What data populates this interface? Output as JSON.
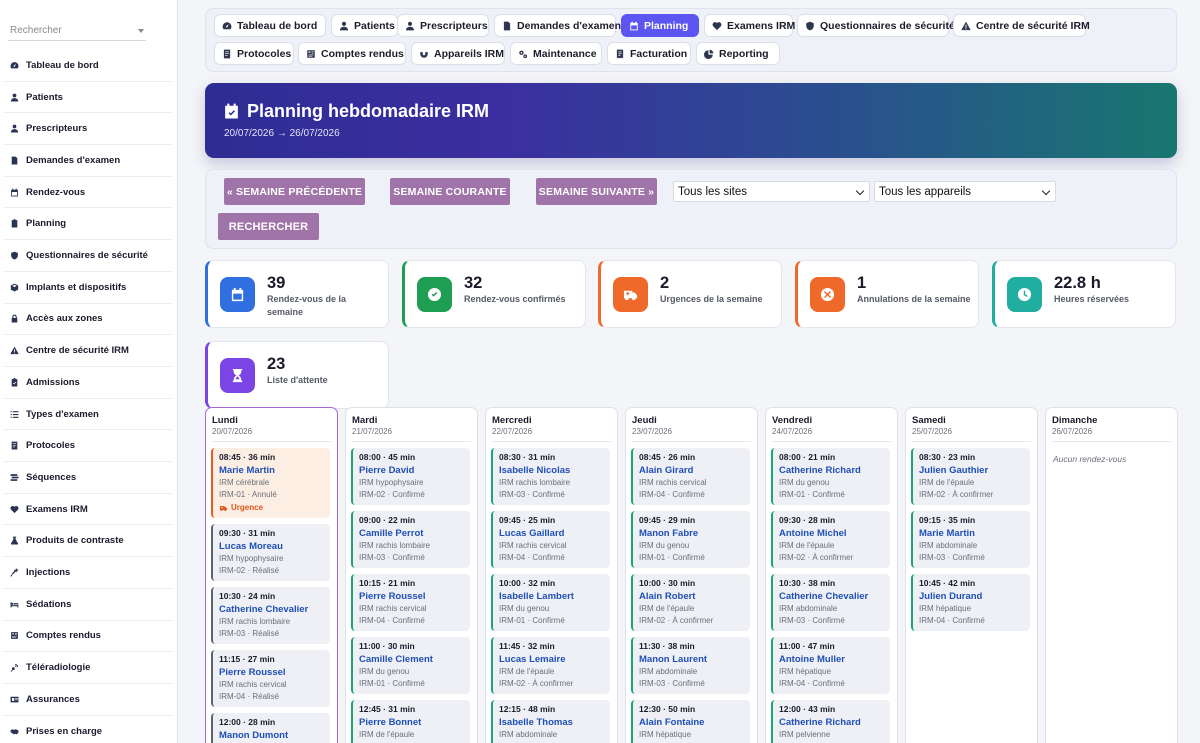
{
  "sidebar": {
    "search_placeholder": "Rechercher",
    "items": [
      {
        "label": "Tableau de bord",
        "icon": "gauge-icon"
      },
      {
        "label": "Patients",
        "icon": "user-icon"
      },
      {
        "label": "Prescripteurs",
        "icon": "doctor-icon"
      },
      {
        "label": "Demandes d'examen",
        "icon": "file-icon"
      },
      {
        "label": "Rendez-vous",
        "icon": "calendar-icon"
      },
      {
        "label": "Planning",
        "icon": "clipboard-icon"
      },
      {
        "label": "Questionnaires de sécurité",
        "icon": "shield-icon"
      },
      {
        "label": "Implants et dispositifs",
        "icon": "box-icon"
      },
      {
        "label": "Accès aux zones",
        "icon": "lock-icon"
      },
      {
        "label": "Centre de sécurité IRM",
        "icon": "warning-icon"
      },
      {
        "label": "Admissions",
        "icon": "clipboard-check-icon"
      },
      {
        "label": "Types d'examen",
        "icon": "list-icon"
      },
      {
        "label": "Protocoles",
        "icon": "doc-icon"
      },
      {
        "label": "Séquences",
        "icon": "stream-icon"
      },
      {
        "label": "Examens IRM",
        "icon": "heart-pulse-icon"
      },
      {
        "label": "Produits de contraste",
        "icon": "flask-icon"
      },
      {
        "label": "Injections",
        "icon": "syringe-icon"
      },
      {
        "label": "Sédations",
        "icon": "bed-icon"
      },
      {
        "label": "Comptes rendus",
        "icon": "report-icon"
      },
      {
        "label": "Téléradiologie",
        "icon": "satellite-icon"
      },
      {
        "label": "Assurances",
        "icon": "id-card-icon"
      },
      {
        "label": "Prises en charge",
        "icon": "handshake-icon"
      }
    ]
  },
  "topnav": {
    "tabs": [
      {
        "label": "Tableau de bord",
        "icon": "gauge-icon"
      },
      {
        "label": "Patients",
        "icon": "user-icon"
      },
      {
        "label": "Prescripteurs",
        "icon": "doctor-icon"
      },
      {
        "label": "Demandes d'examen",
        "icon": "file-icon"
      },
      {
        "label": "Planning",
        "icon": "calendar-icon",
        "active": true
      },
      {
        "label": "Examens IRM",
        "icon": "heart-pulse-icon"
      },
      {
        "label": "Questionnaires de sécurité",
        "icon": "shield-icon"
      },
      {
        "label": "Centre de sécurité IRM",
        "icon": "warning-icon"
      },
      {
        "label": "Protocoles",
        "icon": "doc-icon"
      },
      {
        "label": "Comptes rendus",
        "icon": "report-icon"
      },
      {
        "label": "Appareils IRM",
        "icon": "magnet-icon"
      },
      {
        "label": "Maintenance",
        "icon": "gears-icon"
      },
      {
        "label": "Facturation",
        "icon": "invoice-icon"
      },
      {
        "label": "Reporting",
        "icon": "chart-pie-icon"
      }
    ]
  },
  "hero": {
    "title": "Planning hebdomadaire IRM",
    "dates": "20/07/2026 → 26/07/2026"
  },
  "filters": {
    "prev_week": "« SEMAINE PRÉCÉDENTE",
    "current_week": "SEMAINE COURANTE",
    "next_week": "SEMAINE SUIVANTE »",
    "site_select": "Tous les sites",
    "device_select": "Tous les appareils",
    "search": "RECHERCHER"
  },
  "stats": [
    {
      "value": "39",
      "label": "Rendez-vous de la semaine",
      "color": "#2f6fe0",
      "icon": "calendar-icon"
    },
    {
      "value": "32",
      "label": "Rendez-vous confirmés",
      "color": "#1e9e52",
      "icon": "check-circle-icon"
    },
    {
      "value": "2",
      "label": "Urgences de la semaine",
      "color": "#ef6a2a",
      "icon": "ambulance-icon"
    },
    {
      "value": "1",
      "label": "Annulations de la semaine",
      "color": "#ef6a2a",
      "icon": "cancel-circle-icon"
    },
    {
      "value": "22.8 h",
      "label": "Heures réservées",
      "color": "#1fae9f",
      "icon": "clock-icon"
    },
    {
      "value": "23",
      "label": "Liste d'attente",
      "color": "#7b45e6",
      "icon": "hourglass-icon"
    }
  ],
  "days": [
    {
      "name": "Lundi",
      "date": "20/07/2026",
      "today": true,
      "appointments": [
        {
          "time": "08:45 · 36 min",
          "patient": "Marie Martin",
          "exam": "IRM cérébrale",
          "status": "IRM-01 · Annulé",
          "kind": "urg",
          "badge": "Urgence"
        },
        {
          "time": "09:30 · 31 min",
          "patient": "Lucas Moreau",
          "exam": "IRM hypophysaire",
          "status": "IRM-02 · Réalisé",
          "kind": "done"
        },
        {
          "time": "10:30 · 24 min",
          "patient": "Catherine Chevalier",
          "exam": "IRM rachis lombaire",
          "status": "IRM-03 · Réalisé",
          "kind": "done"
        },
        {
          "time": "11:15 · 27 min",
          "patient": "Pierre Roussel",
          "exam": "IRM rachis cervical",
          "status": "IRM-04 · Réalisé",
          "kind": "done"
        },
        {
          "time": "12:00 · 28 min",
          "patient": "Manon Dumont",
          "exam": "",
          "status": "",
          "kind": "done"
        }
      ]
    },
    {
      "name": "Mardi",
      "date": "21/07/2026",
      "appointments": [
        {
          "time": "08:00 · 45 min",
          "patient": "Pierre David",
          "exam": "IRM hypophysaire",
          "status": "IRM-02 · Confirmé",
          "kind": "ok"
        },
        {
          "time": "09:00 · 22 min",
          "patient": "Camille Perrot",
          "exam": "IRM rachis lombaire",
          "status": "IRM-03 · Confirmé",
          "kind": "ok"
        },
        {
          "time": "10:15 · 21 min",
          "patient": "Pierre Roussel",
          "exam": "IRM rachis cervical",
          "status": "IRM-04 · Confirmé",
          "kind": "ok"
        },
        {
          "time": "11:00 · 30 min",
          "patient": "Camille Clement",
          "exam": "IRM du genou",
          "status": "IRM-01 · Confirmé",
          "kind": "ok"
        },
        {
          "time": "12:45 · 31 min",
          "patient": "Pierre Bonnet",
          "exam": "IRM de l'épaule",
          "status": "",
          "kind": "ok"
        }
      ]
    },
    {
      "name": "Mercredi",
      "date": "22/07/2026",
      "appointments": [
        {
          "time": "08:30 · 31 min",
          "patient": "Isabelle Nicolas",
          "exam": "IRM rachis lombaire",
          "status": "IRM-03 · Confirmé",
          "kind": "ok"
        },
        {
          "time": "09:45 · 25 min",
          "patient": "Lucas Gaillard",
          "exam": "IRM rachis cervical",
          "status": "IRM-04 · Confirmé",
          "kind": "ok"
        },
        {
          "time": "10:00 · 32 min",
          "patient": "Isabelle Lambert",
          "exam": "IRM du genou",
          "status": "IRM-01 · Confirmé",
          "kind": "ok"
        },
        {
          "time": "11:45 · 32 min",
          "patient": "Lucas Lemaire",
          "exam": "IRM de l'épaule",
          "status": "IRM-02 · À confirmer",
          "kind": "ok"
        },
        {
          "time": "12:15 · 48 min",
          "patient": "Isabelle Thomas",
          "exam": "IRM abdominale",
          "status": "",
          "kind": "ok"
        }
      ]
    },
    {
      "name": "Jeudi",
      "date": "23/07/2026",
      "appointments": [
        {
          "time": "08:45 · 26 min",
          "patient": "Alain Girard",
          "exam": "IRM rachis cervical",
          "status": "IRM-04 · Confirmé",
          "kind": "ok"
        },
        {
          "time": "09:45 · 29 min",
          "patient": "Manon Fabre",
          "exam": "IRM du genou",
          "status": "IRM-01 · Confirmé",
          "kind": "ok"
        },
        {
          "time": "10:00 · 30 min",
          "patient": "Alain Robert",
          "exam": "IRM de l'épaule",
          "status": "IRM-02 · À confirmer",
          "kind": "ok"
        },
        {
          "time": "11:30 · 38 min",
          "patient": "Manon Laurent",
          "exam": "IRM abdominale",
          "status": "IRM-03 · Confirmé",
          "kind": "ok"
        },
        {
          "time": "12:30 · 50 min",
          "patient": "Alain Fontaine",
          "exam": "IRM hépatique",
          "status": "",
          "kind": "ok"
        }
      ]
    },
    {
      "name": "Vendredi",
      "date": "24/07/2026",
      "appointments": [
        {
          "time": "08:00 · 21 min",
          "patient": "Catherine Richard",
          "exam": "IRM du genou",
          "status": "IRM-01 · Confirmé",
          "kind": "ok"
        },
        {
          "time": "09:30 · 28 min",
          "patient": "Antoine Michel",
          "exam": "IRM de l'épaule",
          "status": "IRM-02 · À confirmer",
          "kind": "ok"
        },
        {
          "time": "10:30 · 38 min",
          "patient": "Catherine Chevalier",
          "exam": "IRM abdominale",
          "status": "IRM-03 · Confirmé",
          "kind": "ok"
        },
        {
          "time": "11:00 · 47 min",
          "patient": "Antoine Muller",
          "exam": "IRM hépatique",
          "status": "IRM-04 · Confirmé",
          "kind": "ok"
        },
        {
          "time": "12:00 · 43 min",
          "patient": "Catherine Richard",
          "exam": "IRM pelvienne",
          "status": "",
          "kind": "ok"
        }
      ]
    },
    {
      "name": "Samedi",
      "date": "25/07/2026",
      "appointments": [
        {
          "time": "08:30 · 23 min",
          "patient": "Julien Gauthier",
          "exam": "IRM de l'épaule",
          "status": "IRM-02 · À confirmer",
          "kind": "ok"
        },
        {
          "time": "09:15 · 35 min",
          "patient": "Marie Martin",
          "exam": "IRM abdominale",
          "status": "IRM-03 · Confirmé",
          "kind": "ok"
        },
        {
          "time": "10:45 · 42 min",
          "patient": "Julien Durand",
          "exam": "IRM hépatique",
          "status": "IRM-04 · Confirmé",
          "kind": "ok"
        }
      ]
    },
    {
      "name": "Dimanche",
      "date": "26/07/2026",
      "empty_text": "Aucun rendez-vous",
      "appointments": []
    }
  ]
}
